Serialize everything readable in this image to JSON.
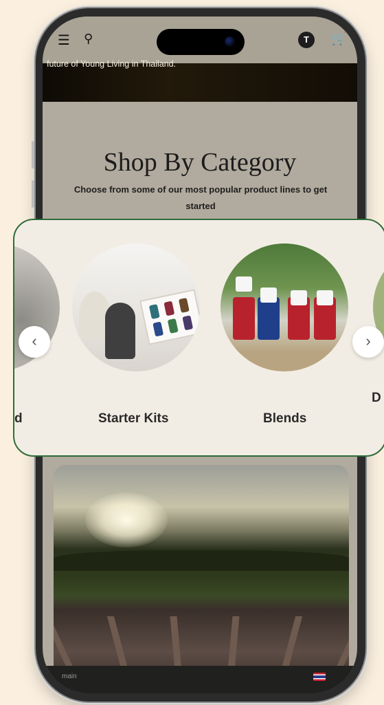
{
  "header": {
    "avatar_initial": "T"
  },
  "hero": {
    "caption": "future of Young Living in Thailand."
  },
  "section": {
    "title": "Shop By Category",
    "subtitle": "Choose from some of our most popular product lines to get started"
  },
  "carousel": {
    "left_partial_label": "d",
    "items": [
      {
        "label": "Starter Kits"
      },
      {
        "label": "Blends"
      }
    ],
    "right_partial_label": "D",
    "prev_glyph": "‹",
    "next_glyph": "›"
  },
  "bottom_bar": {
    "tab_text": "main"
  },
  "colors": {
    "accent_border": "#2e6b3a",
    "background": "#fbf0e0"
  }
}
